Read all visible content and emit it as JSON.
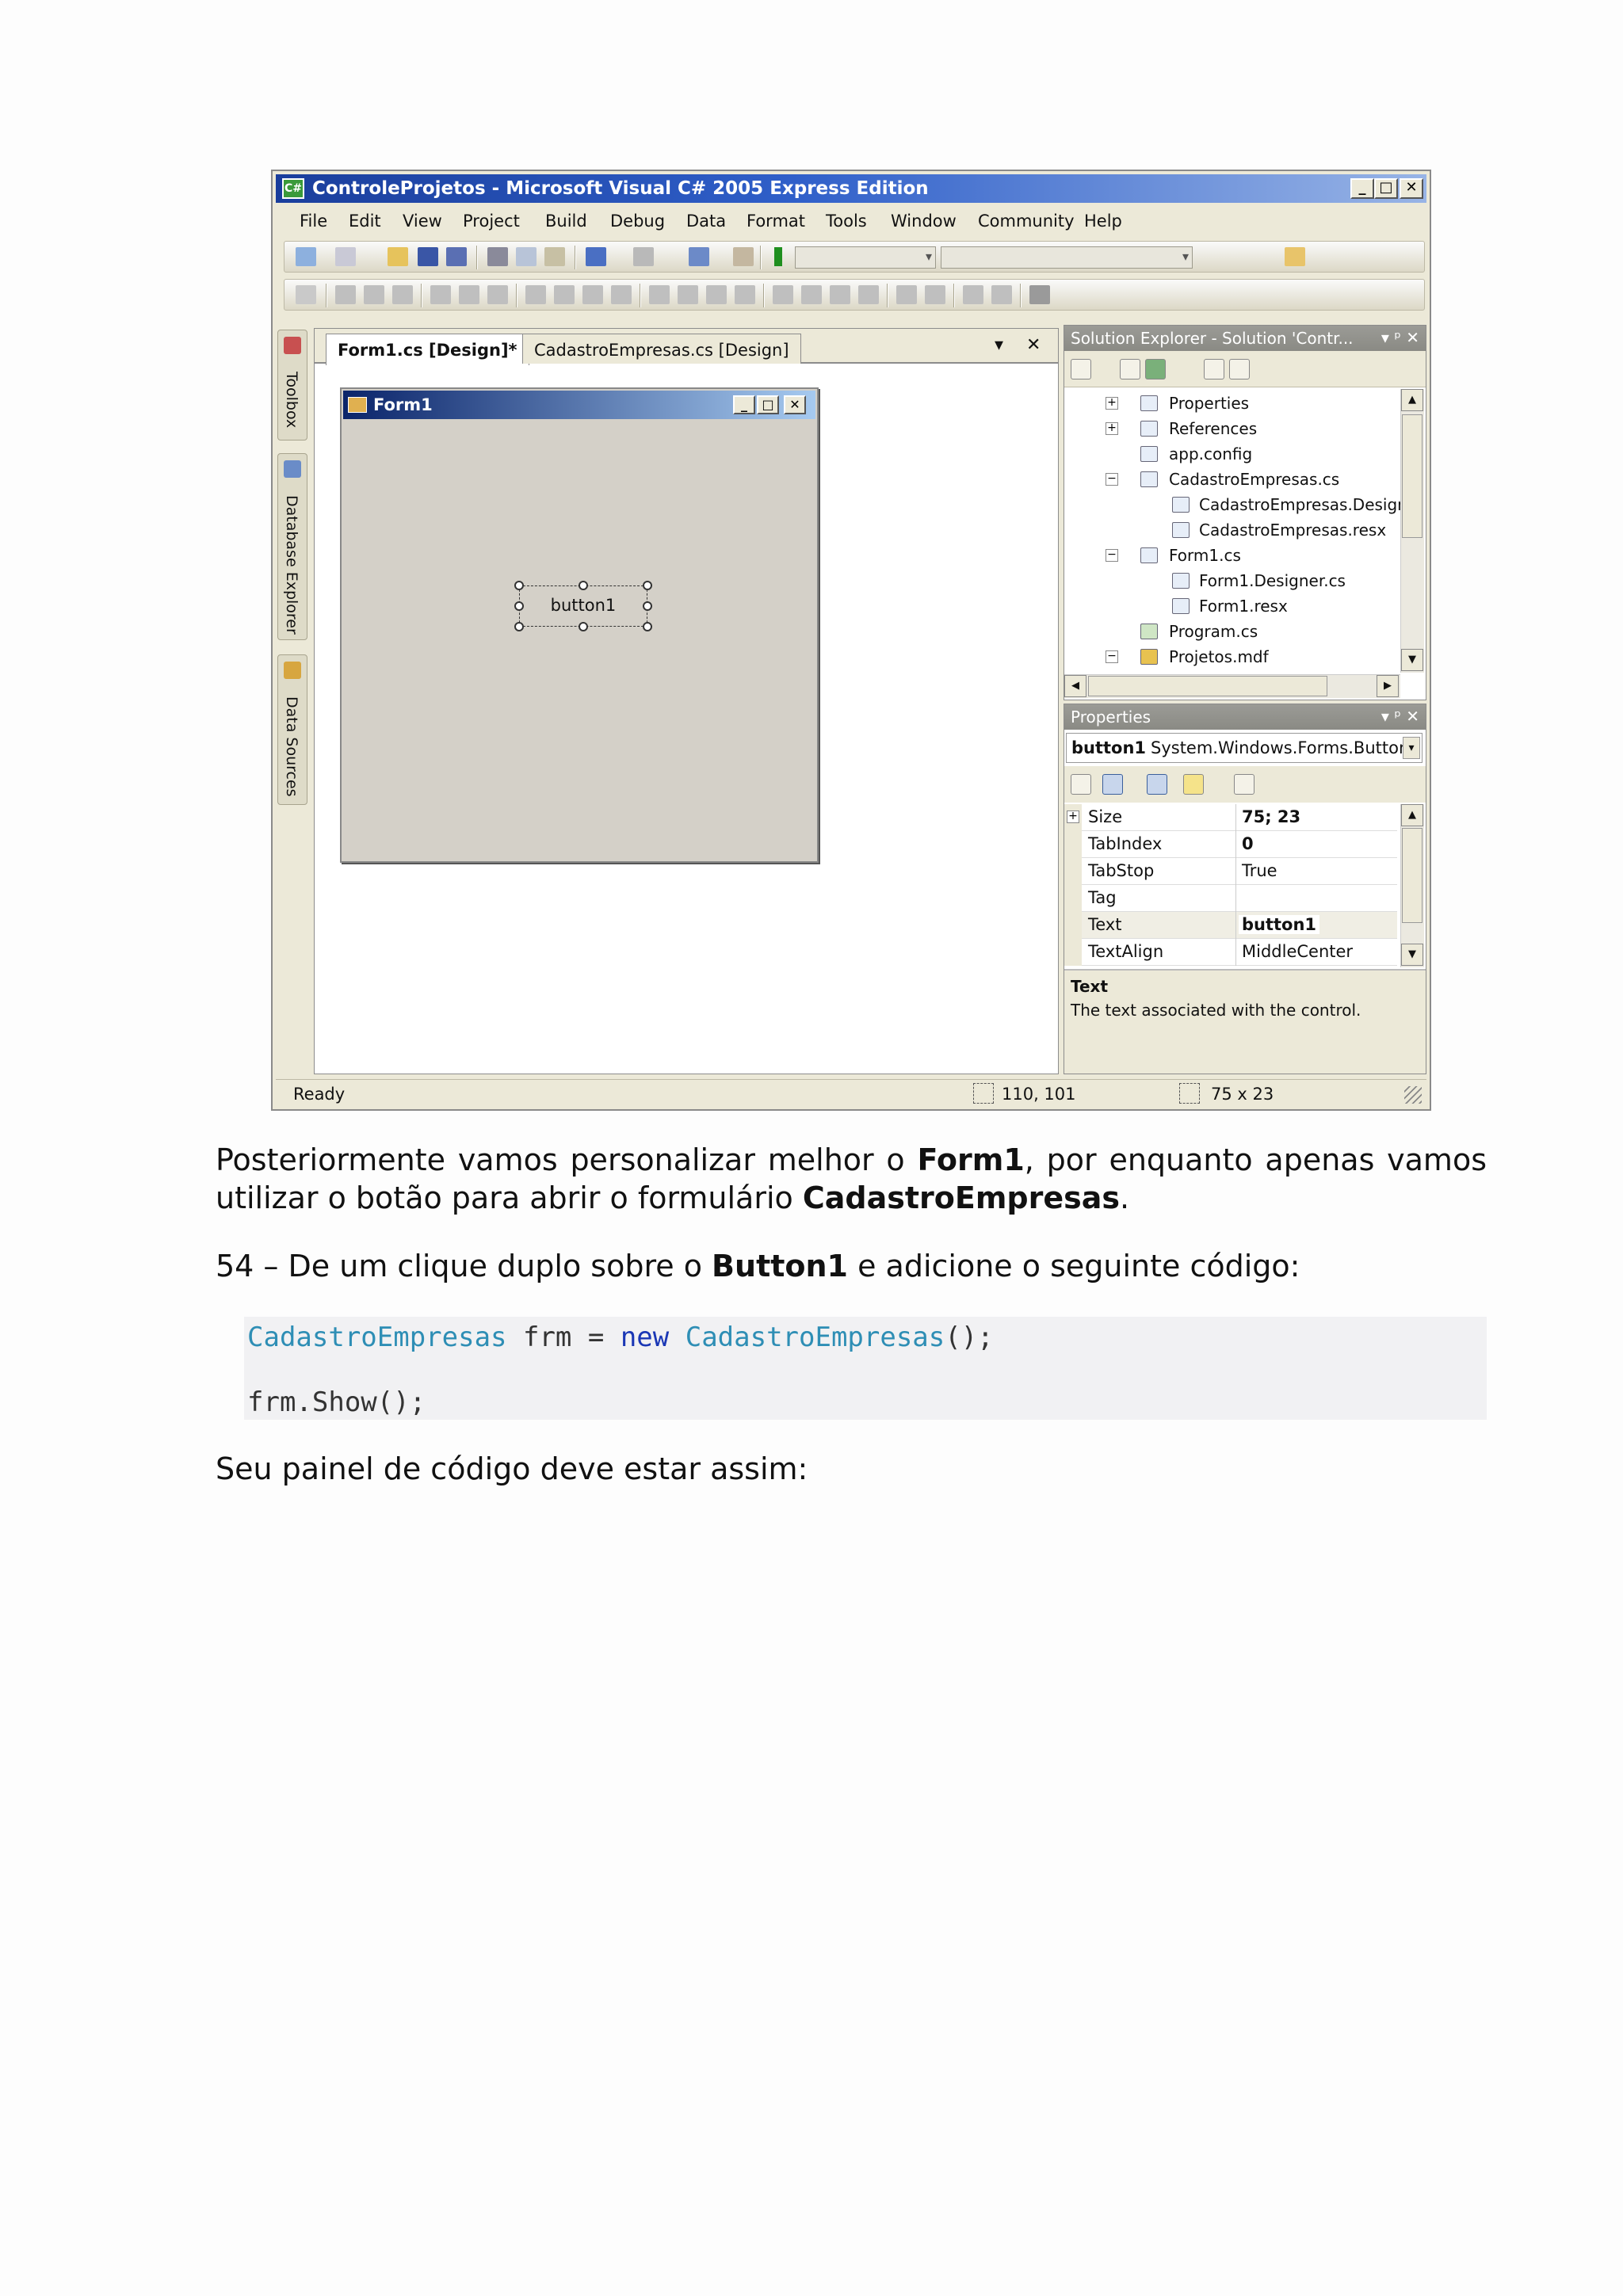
{
  "window": {
    "title": "ControleProjetos - Microsoft Visual C# 2005 Express Edition",
    "buttons": [
      "_",
      "□",
      "✕"
    ]
  },
  "menu": [
    "File",
    "Edit",
    "View",
    "Project",
    "Build",
    "Debug",
    "Data",
    "Format",
    "Tools",
    "Window",
    "Community",
    "Help"
  ],
  "side_tabs": [
    "Toolbox",
    "Database Explorer",
    "Data Sources"
  ],
  "doc_tabs": [
    "Form1.cs [Design]*",
    "CadastroEmpresas.cs [Design]"
  ],
  "doc_tab_controls": [
    "▾",
    "✕"
  ],
  "form1": {
    "title": "Form1",
    "buttons": [
      "_",
      "□",
      "✕"
    ],
    "button_label": "button1"
  },
  "solution_explorer": {
    "title": "Solution Explorer - Solution 'Contr...",
    "controls": "▾ ᵖ ✕",
    "items": [
      {
        "label": "Properties",
        "icon": "folder-properties-icon"
      },
      {
        "label": "References",
        "icon": "references-icon"
      },
      {
        "label": "app.config",
        "icon": "config-file-icon"
      },
      {
        "label": "CadastroEmpresas.cs",
        "icon": "form-file-icon"
      },
      {
        "label": "CadastroEmpresas.Designer.cs",
        "icon": "code-file-icon"
      },
      {
        "label": "CadastroEmpresas.resx",
        "icon": "resource-file-icon"
      },
      {
        "label": "Form1.cs",
        "icon": "form-file-icon"
      },
      {
        "label": "Form1.Designer.cs",
        "icon": "code-file-icon"
      },
      {
        "label": "Form1.resx",
        "icon": "resource-file-icon"
      },
      {
        "label": "Program.cs",
        "icon": "csharp-file-icon"
      },
      {
        "label": "Projetos.mdf",
        "icon": "database-file-icon"
      }
    ]
  },
  "properties": {
    "title": "Properties",
    "controls": "▾ ᵖ ✕",
    "selector_name": "button1",
    "selector_type": "System.Windows.Forms.Button",
    "rows": [
      {
        "name": "Size",
        "value": "75; 23",
        "expander": "+",
        "bold": true
      },
      {
        "name": "TabIndex",
        "value": "0",
        "expander": "",
        "bold": true
      },
      {
        "name": "TabStop",
        "value": "True",
        "expander": "",
        "bold": false
      },
      {
        "name": "Tag",
        "value": "",
        "expander": "",
        "bold": false
      },
      {
        "name": "Text",
        "value": "button1",
        "expander": "",
        "bold": true
      },
      {
        "name": "TextAlign",
        "value": "MiddleCenter",
        "expander": "",
        "bold": false
      }
    ],
    "desc_title": "Text",
    "desc_text": "The text associated with the control."
  },
  "status": {
    "text": "Ready",
    "position": "110, 101",
    "size": "75 x 23"
  },
  "document": {
    "p1_a": "Posteriormente vamos personalizar melhor o ",
    "p1_b": "Form1",
    "p1_c": ", por enquanto apenas vamos utilizar o botão para abrir o formulário ",
    "p1_d": "CadastroEmpresas",
    "p1_e": ".",
    "p2_a": "54 – De um clique duplo sobre o ",
    "p2_b": "Button1",
    "p2_c": " e adicione o seguinte código:",
    "code1_type": "CadastroEmpresas",
    "code1_mid": " frm = ",
    "code1_kw": "new",
    "code1_sp": " ",
    "code1_ctor": "CadastroEmpresas",
    "code1_end": "();",
    "code2": "frm.Show();",
    "p3": "Seu painel de código deve estar assim:"
  },
  "colors": {
    "code_type": "#2e8eb5",
    "code_keyword": "#1a37b5",
    "title_bar": "#1a3e9c",
    "form_title": "#0a246a"
  }
}
